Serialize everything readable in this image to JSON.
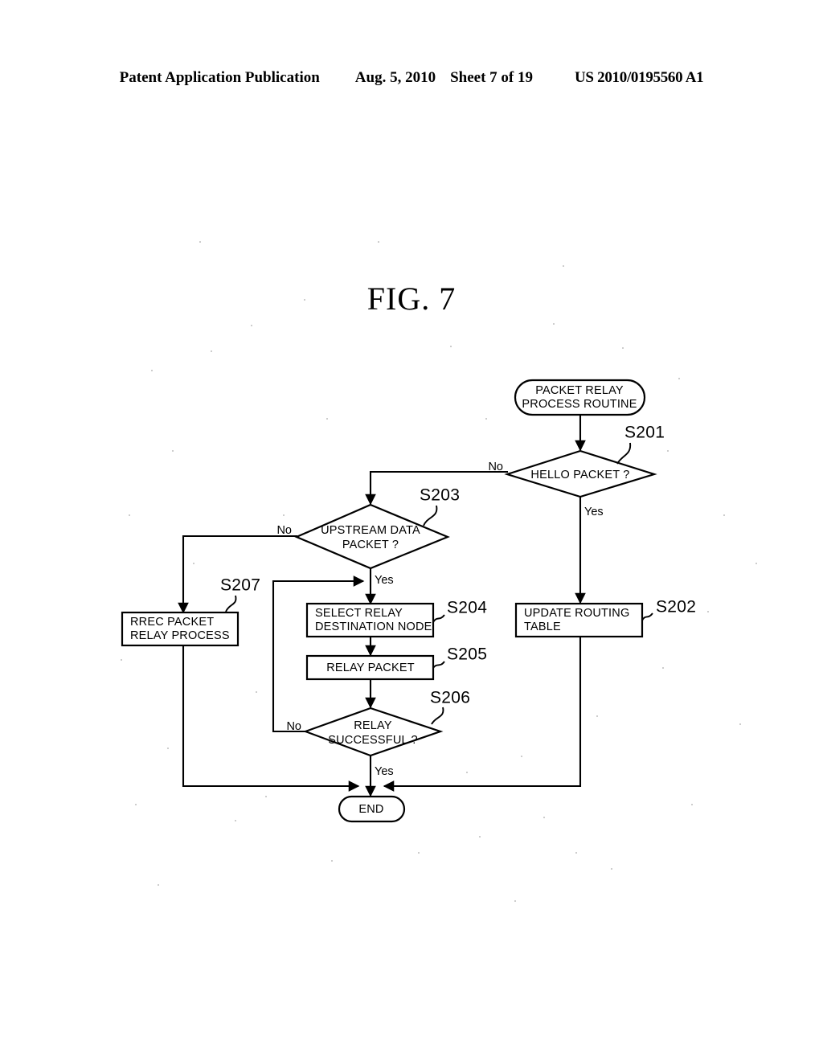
{
  "header": {
    "publication": "Patent Application Publication",
    "date": "Aug. 5, 2010",
    "sheet": "Sheet 7 of 19",
    "patent_number": "US 2010/0195560 A1"
  },
  "figure": {
    "title": "FIG. 7"
  },
  "flowchart": {
    "nodes": {
      "start": {
        "type": "terminator",
        "line1": "PACKET RELAY",
        "line2": "PROCESS ROUTINE"
      },
      "hello_packet": {
        "type": "decision",
        "line1": "HELLO PACKET ?",
        "step": "S201"
      },
      "update_routing_table": {
        "type": "process",
        "line1": "UPDATE ROUTING",
        "line2": "TABLE",
        "step": "S202"
      },
      "upstream_data_packet": {
        "type": "decision",
        "line1": "UPSTREAM DATA",
        "line2": "PACKET ?",
        "step": "S203"
      },
      "select_relay_destination": {
        "type": "process",
        "line1": "SELECT RELAY",
        "line2": "DESTINATION NODE",
        "step": "S204"
      },
      "relay_packet": {
        "type": "process",
        "line1": "RELAY PACKET",
        "step": "S205"
      },
      "relay_successful": {
        "type": "decision",
        "line1": "RELAY",
        "line2": "SUCCESSFUL ?",
        "step": "S206"
      },
      "rrec_packet_relay_process": {
        "type": "process",
        "line1": "RREC PACKET",
        "line2": "RELAY PROCESS",
        "step": "S207"
      },
      "end": {
        "type": "terminator",
        "line1": "END"
      }
    },
    "branch_labels": {
      "hello_no": "No",
      "hello_yes": "Yes",
      "upstream_no": "No",
      "upstream_yes": "Yes",
      "relay_no": "No",
      "relay_yes": "Yes"
    },
    "colors": {
      "stroke": "#000000",
      "fill": "#ffffff",
      "background": "#ffffff"
    }
  }
}
